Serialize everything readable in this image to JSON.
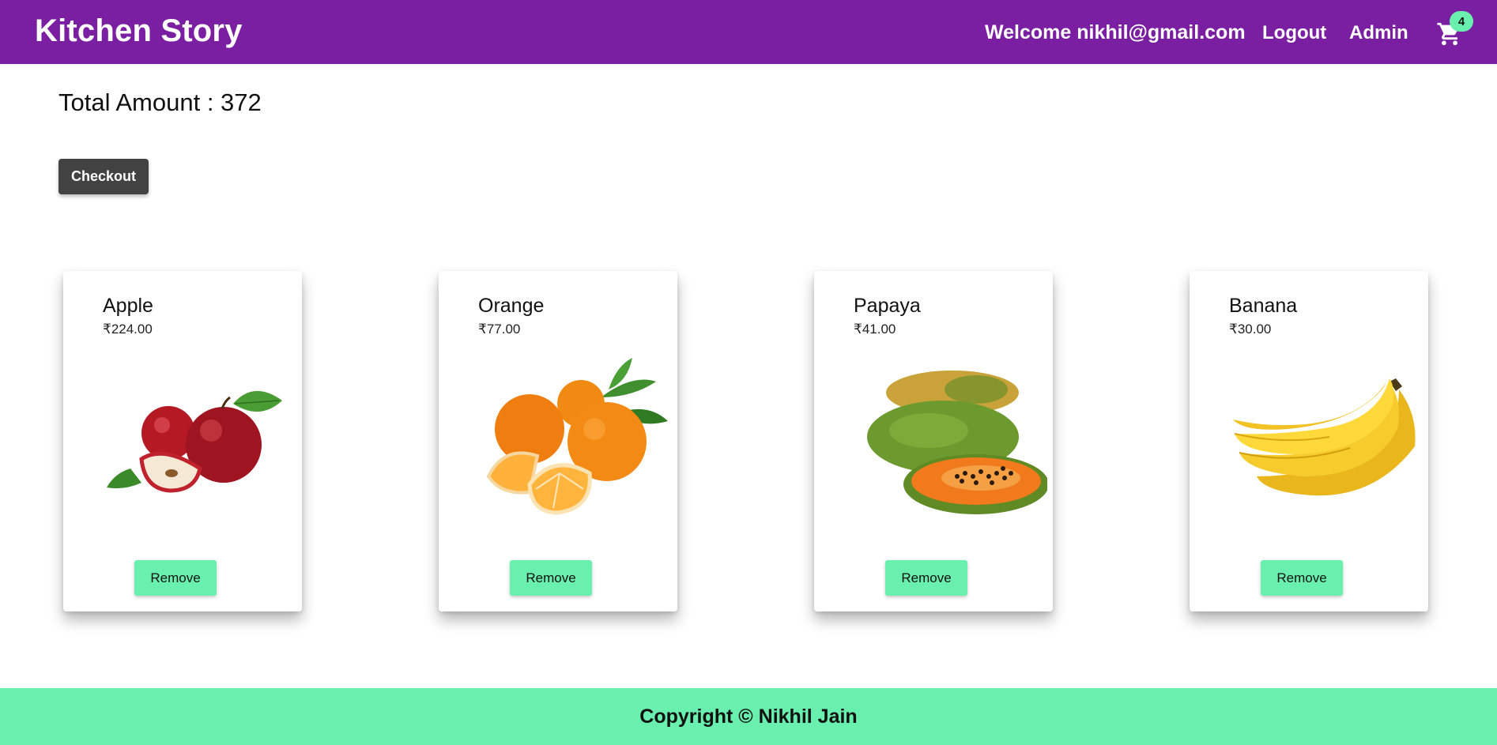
{
  "navbar": {
    "brand": "Kitchen Story",
    "welcome": "Welcome nikhil@gmail.com",
    "logout_label": "Logout",
    "admin_label": "Admin",
    "cart_count": "4",
    "cart_icon": "shopping-cart-icon",
    "background_color": "#7b1fa2"
  },
  "summary": {
    "total_text": "Total Amount : 372",
    "checkout_label": "Checkout"
  },
  "cart_items": [
    {
      "name": "Apple",
      "price": "₹224.00",
      "remove_label": "Remove",
      "image": "apple-image"
    },
    {
      "name": "Orange",
      "price": "₹77.00",
      "remove_label": "Remove",
      "image": "orange-image"
    },
    {
      "name": "Papaya",
      "price": "₹41.00",
      "remove_label": "Remove",
      "image": "papaya-image"
    },
    {
      "name": "Banana",
      "price": "₹30.00",
      "remove_label": "Remove",
      "image": "banana-image"
    }
  ],
  "footer": {
    "text": "Copyright © Nikhil Jain",
    "background_color": "#69f0ae"
  }
}
